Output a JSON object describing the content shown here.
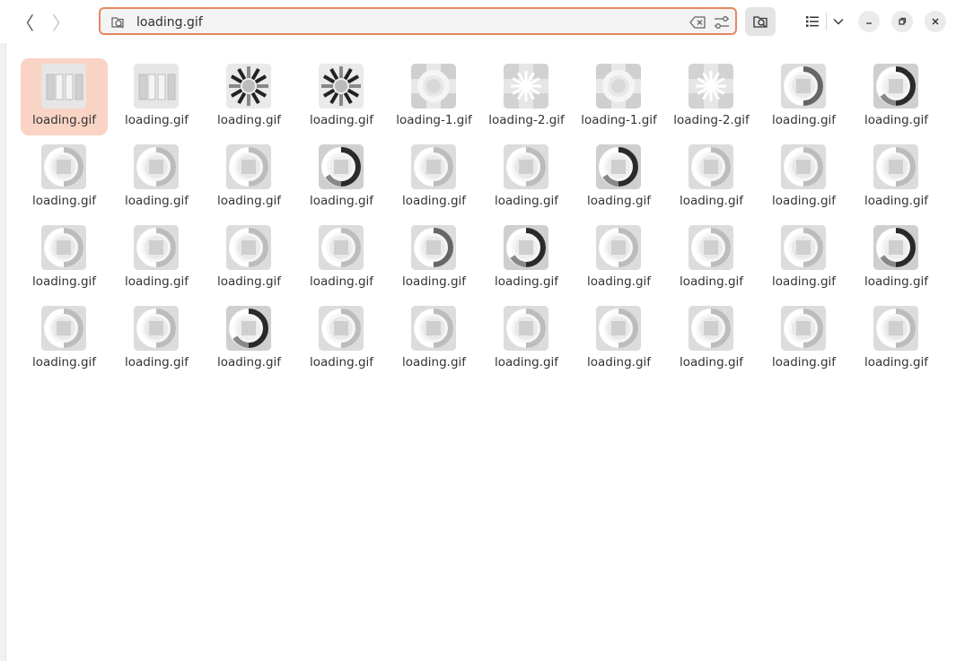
{
  "nav": {
    "back": "〈",
    "forward": "〉"
  },
  "search": {
    "value": "loading.gif",
    "placeholder": ""
  },
  "colors": {
    "accent": "#e8875e",
    "selection": "#f9d4c5"
  },
  "files": [
    {
      "name": "loading.gif",
      "kind": "bars",
      "selected": true
    },
    {
      "name": "loading.gif",
      "kind": "bars"
    },
    {
      "name": "loading.gif",
      "kind": "spokes-dark"
    },
    {
      "name": "loading.gif",
      "kind": "spokes-dark"
    },
    {
      "name": "loading-1.gif",
      "kind": "ring-light"
    },
    {
      "name": "loading-2.gif",
      "kind": "star-light"
    },
    {
      "name": "loading-1.gif",
      "kind": "ring-light"
    },
    {
      "name": "loading-2.gif",
      "kind": "star-light"
    },
    {
      "name": "loading.gif",
      "kind": "circle-mid"
    },
    {
      "name": "loading.gif",
      "kind": "circle-dark"
    },
    {
      "name": "loading.gif",
      "kind": "circle-light"
    },
    {
      "name": "loading.gif",
      "kind": "circle-light"
    },
    {
      "name": "loading.gif",
      "kind": "circle-light"
    },
    {
      "name": "loading.gif",
      "kind": "circle-dark"
    },
    {
      "name": "loading.gif",
      "kind": "circle-light"
    },
    {
      "name": "loading.gif",
      "kind": "circle-light"
    },
    {
      "name": "loading.gif",
      "kind": "circle-dark"
    },
    {
      "name": "loading.gif",
      "kind": "circle-light"
    },
    {
      "name": "loading.gif",
      "kind": "circle-light"
    },
    {
      "name": "loading.gif",
      "kind": "circle-light"
    },
    {
      "name": "loading.gif",
      "kind": "circle-light"
    },
    {
      "name": "loading.gif",
      "kind": "circle-light"
    },
    {
      "name": "loading.gif",
      "kind": "circle-light"
    },
    {
      "name": "loading.gif",
      "kind": "circle-light"
    },
    {
      "name": "loading.gif",
      "kind": "circle-mid"
    },
    {
      "name": "loading.gif",
      "kind": "circle-dark"
    },
    {
      "name": "loading.gif",
      "kind": "circle-light"
    },
    {
      "name": "loading.gif",
      "kind": "circle-light"
    },
    {
      "name": "loading.gif",
      "kind": "circle-light"
    },
    {
      "name": "loading.gif",
      "kind": "circle-dark"
    },
    {
      "name": "loading.gif",
      "kind": "circle-light"
    },
    {
      "name": "loading.gif",
      "kind": "circle-light"
    },
    {
      "name": "loading.gif",
      "kind": "circle-dark"
    },
    {
      "name": "loading.gif",
      "kind": "circle-light"
    },
    {
      "name": "loading.gif",
      "kind": "circle-light"
    },
    {
      "name": "loading.gif",
      "kind": "circle-light"
    },
    {
      "name": "loading.gif",
      "kind": "circle-light"
    },
    {
      "name": "loading.gif",
      "kind": "circle-light"
    },
    {
      "name": "loading.gif",
      "kind": "circle-light"
    },
    {
      "name": "loading.gif",
      "kind": "circle-light"
    }
  ]
}
